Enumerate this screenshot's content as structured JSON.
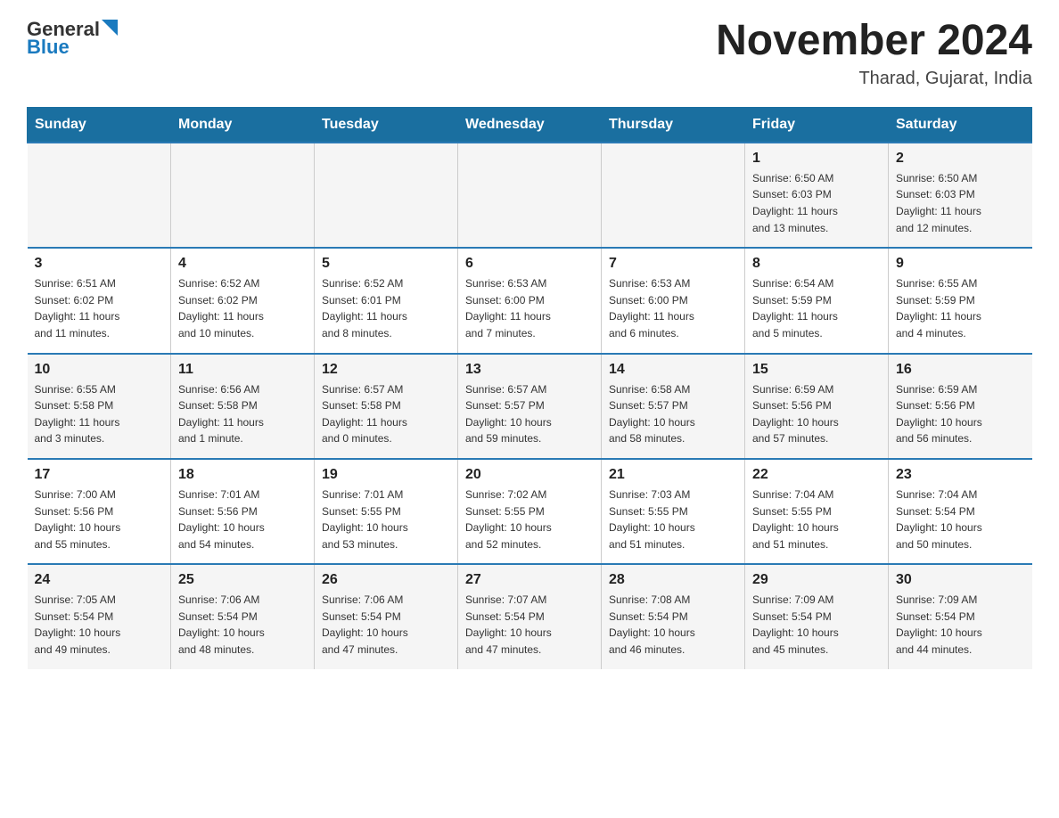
{
  "logo": {
    "general": "General",
    "blue": "Blue"
  },
  "title": "November 2024",
  "subtitle": "Tharad, Gujarat, India",
  "weekdays": [
    "Sunday",
    "Monday",
    "Tuesday",
    "Wednesday",
    "Thursday",
    "Friday",
    "Saturday"
  ],
  "weeks": [
    [
      {
        "day": "",
        "info": ""
      },
      {
        "day": "",
        "info": ""
      },
      {
        "day": "",
        "info": ""
      },
      {
        "day": "",
        "info": ""
      },
      {
        "day": "",
        "info": ""
      },
      {
        "day": "1",
        "info": "Sunrise: 6:50 AM\nSunset: 6:03 PM\nDaylight: 11 hours\nand 13 minutes."
      },
      {
        "day": "2",
        "info": "Sunrise: 6:50 AM\nSunset: 6:03 PM\nDaylight: 11 hours\nand 12 minutes."
      }
    ],
    [
      {
        "day": "3",
        "info": "Sunrise: 6:51 AM\nSunset: 6:02 PM\nDaylight: 11 hours\nand 11 minutes."
      },
      {
        "day": "4",
        "info": "Sunrise: 6:52 AM\nSunset: 6:02 PM\nDaylight: 11 hours\nand 10 minutes."
      },
      {
        "day": "5",
        "info": "Sunrise: 6:52 AM\nSunset: 6:01 PM\nDaylight: 11 hours\nand 8 minutes."
      },
      {
        "day": "6",
        "info": "Sunrise: 6:53 AM\nSunset: 6:00 PM\nDaylight: 11 hours\nand 7 minutes."
      },
      {
        "day": "7",
        "info": "Sunrise: 6:53 AM\nSunset: 6:00 PM\nDaylight: 11 hours\nand 6 minutes."
      },
      {
        "day": "8",
        "info": "Sunrise: 6:54 AM\nSunset: 5:59 PM\nDaylight: 11 hours\nand 5 minutes."
      },
      {
        "day": "9",
        "info": "Sunrise: 6:55 AM\nSunset: 5:59 PM\nDaylight: 11 hours\nand 4 minutes."
      }
    ],
    [
      {
        "day": "10",
        "info": "Sunrise: 6:55 AM\nSunset: 5:58 PM\nDaylight: 11 hours\nand 3 minutes."
      },
      {
        "day": "11",
        "info": "Sunrise: 6:56 AM\nSunset: 5:58 PM\nDaylight: 11 hours\nand 1 minute."
      },
      {
        "day": "12",
        "info": "Sunrise: 6:57 AM\nSunset: 5:58 PM\nDaylight: 11 hours\nand 0 minutes."
      },
      {
        "day": "13",
        "info": "Sunrise: 6:57 AM\nSunset: 5:57 PM\nDaylight: 10 hours\nand 59 minutes."
      },
      {
        "day": "14",
        "info": "Sunrise: 6:58 AM\nSunset: 5:57 PM\nDaylight: 10 hours\nand 58 minutes."
      },
      {
        "day": "15",
        "info": "Sunrise: 6:59 AM\nSunset: 5:56 PM\nDaylight: 10 hours\nand 57 minutes."
      },
      {
        "day": "16",
        "info": "Sunrise: 6:59 AM\nSunset: 5:56 PM\nDaylight: 10 hours\nand 56 minutes."
      }
    ],
    [
      {
        "day": "17",
        "info": "Sunrise: 7:00 AM\nSunset: 5:56 PM\nDaylight: 10 hours\nand 55 minutes."
      },
      {
        "day": "18",
        "info": "Sunrise: 7:01 AM\nSunset: 5:56 PM\nDaylight: 10 hours\nand 54 minutes."
      },
      {
        "day": "19",
        "info": "Sunrise: 7:01 AM\nSunset: 5:55 PM\nDaylight: 10 hours\nand 53 minutes."
      },
      {
        "day": "20",
        "info": "Sunrise: 7:02 AM\nSunset: 5:55 PM\nDaylight: 10 hours\nand 52 minutes."
      },
      {
        "day": "21",
        "info": "Sunrise: 7:03 AM\nSunset: 5:55 PM\nDaylight: 10 hours\nand 51 minutes."
      },
      {
        "day": "22",
        "info": "Sunrise: 7:04 AM\nSunset: 5:55 PM\nDaylight: 10 hours\nand 51 minutes."
      },
      {
        "day": "23",
        "info": "Sunrise: 7:04 AM\nSunset: 5:54 PM\nDaylight: 10 hours\nand 50 minutes."
      }
    ],
    [
      {
        "day": "24",
        "info": "Sunrise: 7:05 AM\nSunset: 5:54 PM\nDaylight: 10 hours\nand 49 minutes."
      },
      {
        "day": "25",
        "info": "Sunrise: 7:06 AM\nSunset: 5:54 PM\nDaylight: 10 hours\nand 48 minutes."
      },
      {
        "day": "26",
        "info": "Sunrise: 7:06 AM\nSunset: 5:54 PM\nDaylight: 10 hours\nand 47 minutes."
      },
      {
        "day": "27",
        "info": "Sunrise: 7:07 AM\nSunset: 5:54 PM\nDaylight: 10 hours\nand 47 minutes."
      },
      {
        "day": "28",
        "info": "Sunrise: 7:08 AM\nSunset: 5:54 PM\nDaylight: 10 hours\nand 46 minutes."
      },
      {
        "day": "29",
        "info": "Sunrise: 7:09 AM\nSunset: 5:54 PM\nDaylight: 10 hours\nand 45 minutes."
      },
      {
        "day": "30",
        "info": "Sunrise: 7:09 AM\nSunset: 5:54 PM\nDaylight: 10 hours\nand 44 minutes."
      }
    ]
  ]
}
